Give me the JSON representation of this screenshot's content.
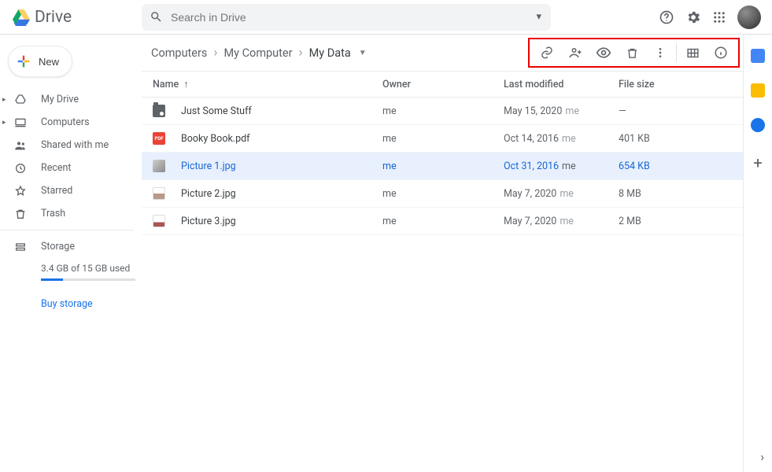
{
  "app": {
    "title": "Drive"
  },
  "search": {
    "placeholder": "Search in Drive"
  },
  "newButton": {
    "label": "New"
  },
  "sidebar": {
    "items": [
      {
        "label": "My Drive"
      },
      {
        "label": "Computers"
      },
      {
        "label": "Shared with me"
      },
      {
        "label": "Recent"
      },
      {
        "label": "Starred"
      },
      {
        "label": "Trash"
      }
    ],
    "storage": {
      "label": "Storage",
      "usageText": "3.4 GB of 15 GB used",
      "buy": "Buy storage"
    }
  },
  "breadcrumb": {
    "segments": [
      "Computers",
      "My Computer",
      "My Data"
    ]
  },
  "columns": {
    "name": "Name",
    "owner": "Owner",
    "modified": "Last modified",
    "size": "File size"
  },
  "rows": [
    {
      "kind": "folder",
      "name": "Just Some Stuff",
      "owner": "me",
      "modified": "May 15, 2020",
      "modBy": "me",
      "size": "—",
      "selected": false
    },
    {
      "kind": "pdf",
      "name": "Booky Book.pdf",
      "owner": "me",
      "modified": "Oct 14, 2016",
      "modBy": "me",
      "size": "401 KB",
      "selected": false
    },
    {
      "kind": "img",
      "name": "Picture 1.jpg",
      "owner": "me",
      "modified": "Oct 31, 2016",
      "modBy": "me",
      "size": "654 KB",
      "selected": true
    },
    {
      "kind": "img2",
      "name": "Picture 2.jpg",
      "owner": "me",
      "modified": "May 7, 2020",
      "modBy": "me",
      "size": "8 MB",
      "selected": false
    },
    {
      "kind": "img3",
      "name": "Picture 3.jpg",
      "owner": "me",
      "modified": "May 7, 2020",
      "modBy": "me",
      "size": "2 MB",
      "selected": false
    }
  ]
}
